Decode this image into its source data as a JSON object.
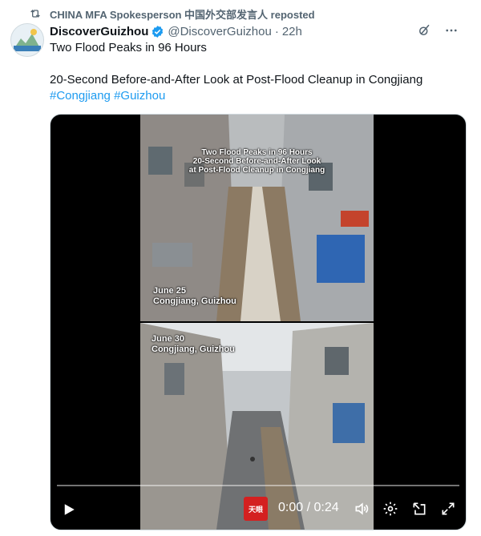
{
  "repost": {
    "text": "CHINA MFA Spokesperson 中国外交部发言人 reposted",
    "icon": "repost-icon"
  },
  "author": {
    "name": "DiscoverGuizhou",
    "handle": "@DiscoverGuizhou",
    "separator": "·",
    "time": "22h",
    "avatar_label": "DISCOVER GUIZHOU",
    "verified_color": "#1d9bf0"
  },
  "post": {
    "line1": "Two Flood Peaks in 96 Hours",
    "line2": "20-Second Before-and-After Look at Post-Flood Cleanup in Congjiang",
    "hashtags": [
      "#Congjiang",
      "#Guizhou"
    ]
  },
  "video": {
    "overlay_title": [
      "Two Flood Peaks in 96 Hours",
      "20-Second Before-and-After Look",
      "at Post-Flood Cleanup in Congjiang"
    ],
    "top_caption": [
      "June 25",
      "Congjiang, Guizhou"
    ],
    "bottom_caption": [
      "June 30",
      "Congjiang, Guizhou"
    ],
    "current_time": "0:00",
    "duration": "0:24",
    "time_separator": "/",
    "watermark": "天眼",
    "progress": 0.0
  },
  "colors": {
    "accent": "#1d9bf0",
    "secondary_text": "#536471"
  }
}
